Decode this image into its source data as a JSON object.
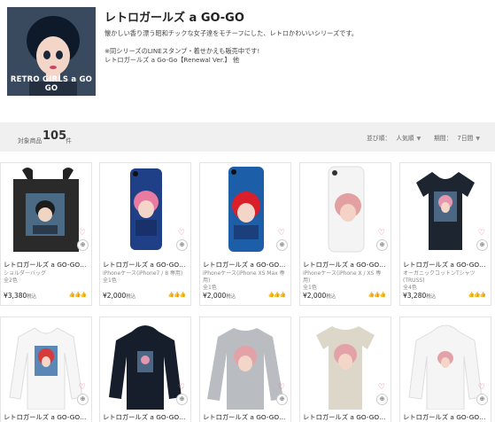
{
  "shop": {
    "title": "レトロガールズ a GO-GO",
    "avatar_text": "RETRO GIRLS a GO GO",
    "desc1": "懐かしい香り漂う昭和チックな女子達をモチーフにした、レトロかわいいシリーズです。",
    "desc2": "※同シリーズのLINEスタンプ・着せかえも販売中です!",
    "desc3": "レトロガールズ a Go-Go【Renewal Ver.】 他"
  },
  "toolbar": {
    "count_label": "対象商品",
    "count": "105",
    "count_unit": "件",
    "sort_label": "並び順：",
    "sort_value": "人気順",
    "period_label": "期間：",
    "period_value": "7日間"
  },
  "products": [
    {
      "name": "レトロガールズ a GO-GO…",
      "type": "ショルダーバッグ",
      "variants": "全2色",
      "price": "¥3,380",
      "tax": "税込",
      "badge": "👍👍👍"
    },
    {
      "name": "レトロガールズ a GO-GO…",
      "type": "iPhoneケース(iPhone7 / 8 専用)",
      "variants": "全1色",
      "price": "¥2,000",
      "tax": "税込",
      "badge": "👍👍👍"
    },
    {
      "name": "レトロガールズ a GO-GO…",
      "type": "iPhoneケース(iPhone XS Max 専用)",
      "variants": "全1色",
      "price": "¥2,000",
      "tax": "税込",
      "badge": "👍👍👍"
    },
    {
      "name": "レトロガールズ a GO-GO…",
      "type": "iPhoneケース(iPhone X / XS 専用)",
      "variants": "全1色",
      "price": "¥2,000",
      "tax": "税込",
      "badge": "👍👍👍"
    },
    {
      "name": "レトロガールズ a GO-GO…",
      "type": "オーガニックコットンTシャツ(TRUSS)",
      "variants": "全4色",
      "price": "¥3,280",
      "tax": "税込",
      "badge": "👍👍👍"
    },
    {
      "name": "レトロガールズ a GO-GO…"
    },
    {
      "name": "レトロガールズ a GO-GO…"
    },
    {
      "name": "レトロガールズ a GO-GO…"
    },
    {
      "name": "レトロガールズ a GO-GO…"
    },
    {
      "name": "レトロガールズ a GO-GO…"
    }
  ],
  "colors": {
    "toolbar_bg": "#f0f0f0",
    "heart": "#e06080",
    "avatar_bg": "#2e3b4c"
  }
}
